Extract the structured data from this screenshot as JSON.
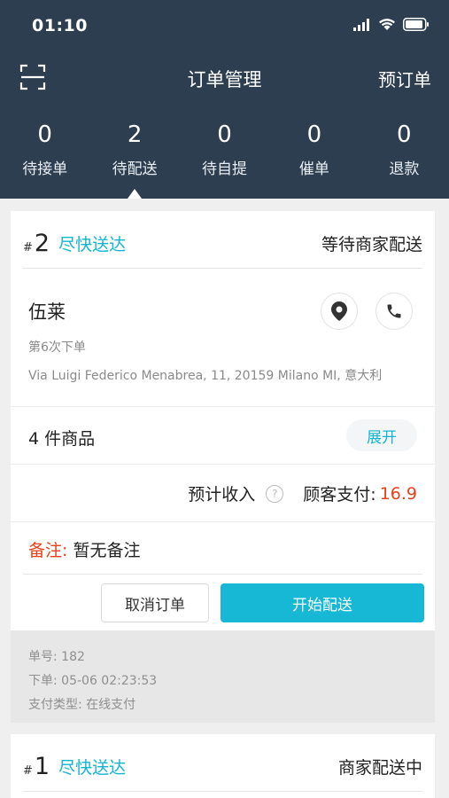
{
  "status_bar": {
    "time": "01:10",
    "signal_icon": "signal-icon",
    "wifi_icon": "wifi-icon",
    "battery_icon": "battery-icon"
  },
  "nav": {
    "scan_icon": "scan-icon",
    "title": "订单管理",
    "right_label": "预订单"
  },
  "stats": [
    {
      "count": "0",
      "label": "待接单"
    },
    {
      "count": "2",
      "label": "待配送"
    },
    {
      "count": "0",
      "label": "待自提"
    },
    {
      "count": "0",
      "label": "催单"
    },
    {
      "count": "0",
      "label": "退款"
    }
  ],
  "orders": [
    {
      "hash": "#",
      "number": "2",
      "delivery": "尽快送达",
      "status": "等待商家配送",
      "customer": {
        "name": "伍莱",
        "order_count": "第6次下单",
        "address": "Via Luigi Federico Menabrea, 11, 20159 Milano MI, 意大利"
      },
      "items": "4 件商品",
      "expand_label": "展开",
      "income_label": "预计收入",
      "paid_label": "顾客支付:",
      "paid_amount": "16.9",
      "note_label": "备注:",
      "note_text": "暂无备注",
      "cancel_label": "取消订单",
      "start_label": "开始配送",
      "meta": {
        "order_id": "单号: 182",
        "placed": "下单: 05-06 02:23:53",
        "pay_type": "支付类型: 在线支付"
      }
    },
    {
      "hash": "#",
      "number": "1",
      "delivery": "尽快送达",
      "status": "商家配送中"
    }
  ],
  "colors": {
    "header_bg": "#2d3e50",
    "accent": "#17b7d6",
    "price_red": "#e8401c"
  }
}
